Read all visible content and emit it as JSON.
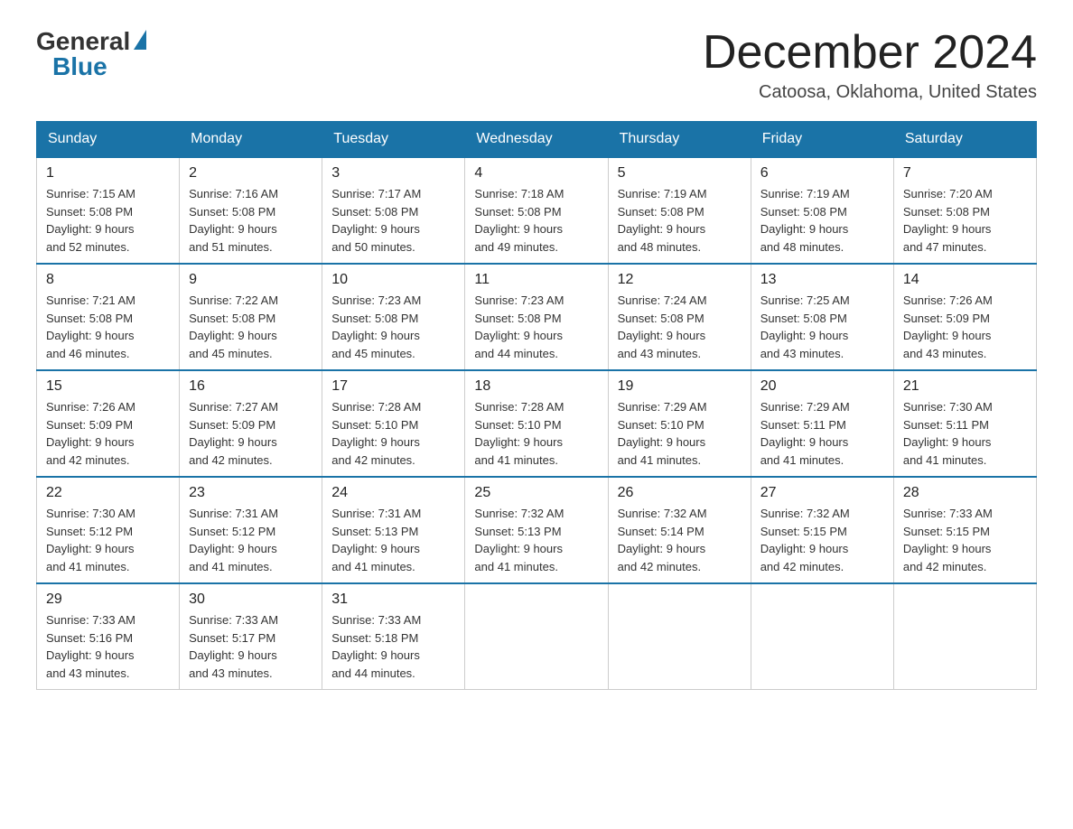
{
  "header": {
    "logo_general": "General",
    "logo_blue": "Blue",
    "title": "December 2024",
    "subtitle": "Catoosa, Oklahoma, United States"
  },
  "days_of_week": [
    "Sunday",
    "Monday",
    "Tuesday",
    "Wednesday",
    "Thursday",
    "Friday",
    "Saturday"
  ],
  "weeks": [
    [
      {
        "day": "1",
        "sunrise": "7:15 AM",
        "sunset": "5:08 PM",
        "daylight": "9 hours and 52 minutes."
      },
      {
        "day": "2",
        "sunrise": "7:16 AM",
        "sunset": "5:08 PM",
        "daylight": "9 hours and 51 minutes."
      },
      {
        "day": "3",
        "sunrise": "7:17 AM",
        "sunset": "5:08 PM",
        "daylight": "9 hours and 50 minutes."
      },
      {
        "day": "4",
        "sunrise": "7:18 AM",
        "sunset": "5:08 PM",
        "daylight": "9 hours and 49 minutes."
      },
      {
        "day": "5",
        "sunrise": "7:19 AM",
        "sunset": "5:08 PM",
        "daylight": "9 hours and 48 minutes."
      },
      {
        "day": "6",
        "sunrise": "7:19 AM",
        "sunset": "5:08 PM",
        "daylight": "9 hours and 48 minutes."
      },
      {
        "day": "7",
        "sunrise": "7:20 AM",
        "sunset": "5:08 PM",
        "daylight": "9 hours and 47 minutes."
      }
    ],
    [
      {
        "day": "8",
        "sunrise": "7:21 AM",
        "sunset": "5:08 PM",
        "daylight": "9 hours and 46 minutes."
      },
      {
        "day": "9",
        "sunrise": "7:22 AM",
        "sunset": "5:08 PM",
        "daylight": "9 hours and 45 minutes."
      },
      {
        "day": "10",
        "sunrise": "7:23 AM",
        "sunset": "5:08 PM",
        "daylight": "9 hours and 45 minutes."
      },
      {
        "day": "11",
        "sunrise": "7:23 AM",
        "sunset": "5:08 PM",
        "daylight": "9 hours and 44 minutes."
      },
      {
        "day": "12",
        "sunrise": "7:24 AM",
        "sunset": "5:08 PM",
        "daylight": "9 hours and 43 minutes."
      },
      {
        "day": "13",
        "sunrise": "7:25 AM",
        "sunset": "5:08 PM",
        "daylight": "9 hours and 43 minutes."
      },
      {
        "day": "14",
        "sunrise": "7:26 AM",
        "sunset": "5:09 PM",
        "daylight": "9 hours and 43 minutes."
      }
    ],
    [
      {
        "day": "15",
        "sunrise": "7:26 AM",
        "sunset": "5:09 PM",
        "daylight": "9 hours and 42 minutes."
      },
      {
        "day": "16",
        "sunrise": "7:27 AM",
        "sunset": "5:09 PM",
        "daylight": "9 hours and 42 minutes."
      },
      {
        "day": "17",
        "sunrise": "7:28 AM",
        "sunset": "5:10 PM",
        "daylight": "9 hours and 42 minutes."
      },
      {
        "day": "18",
        "sunrise": "7:28 AM",
        "sunset": "5:10 PM",
        "daylight": "9 hours and 41 minutes."
      },
      {
        "day": "19",
        "sunrise": "7:29 AM",
        "sunset": "5:10 PM",
        "daylight": "9 hours and 41 minutes."
      },
      {
        "day": "20",
        "sunrise": "7:29 AM",
        "sunset": "5:11 PM",
        "daylight": "9 hours and 41 minutes."
      },
      {
        "day": "21",
        "sunrise": "7:30 AM",
        "sunset": "5:11 PM",
        "daylight": "9 hours and 41 minutes."
      }
    ],
    [
      {
        "day": "22",
        "sunrise": "7:30 AM",
        "sunset": "5:12 PM",
        "daylight": "9 hours and 41 minutes."
      },
      {
        "day": "23",
        "sunrise": "7:31 AM",
        "sunset": "5:12 PM",
        "daylight": "9 hours and 41 minutes."
      },
      {
        "day": "24",
        "sunrise": "7:31 AM",
        "sunset": "5:13 PM",
        "daylight": "9 hours and 41 minutes."
      },
      {
        "day": "25",
        "sunrise": "7:32 AM",
        "sunset": "5:13 PM",
        "daylight": "9 hours and 41 minutes."
      },
      {
        "day": "26",
        "sunrise": "7:32 AM",
        "sunset": "5:14 PM",
        "daylight": "9 hours and 42 minutes."
      },
      {
        "day": "27",
        "sunrise": "7:32 AM",
        "sunset": "5:15 PM",
        "daylight": "9 hours and 42 minutes."
      },
      {
        "day": "28",
        "sunrise": "7:33 AM",
        "sunset": "5:15 PM",
        "daylight": "9 hours and 42 minutes."
      }
    ],
    [
      {
        "day": "29",
        "sunrise": "7:33 AM",
        "sunset": "5:16 PM",
        "daylight": "9 hours and 43 minutes."
      },
      {
        "day": "30",
        "sunrise": "7:33 AM",
        "sunset": "5:17 PM",
        "daylight": "9 hours and 43 minutes."
      },
      {
        "day": "31",
        "sunrise": "7:33 AM",
        "sunset": "5:18 PM",
        "daylight": "9 hours and 44 minutes."
      },
      null,
      null,
      null,
      null
    ]
  ],
  "labels": {
    "sunrise": "Sunrise:",
    "sunset": "Sunset:",
    "daylight": "Daylight:"
  }
}
